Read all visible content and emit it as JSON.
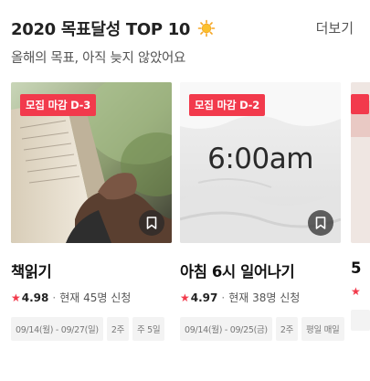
{
  "header": {
    "title": "2020 목표달성 TOP 10",
    "title_icon": "sun-icon",
    "more_label": "더보기",
    "subtitle": "올해의 목표, 아직 늦지 않았어요"
  },
  "cards": [
    {
      "badge": "모집 마감 D-3",
      "title": "책읽기",
      "rating": "4.98",
      "participants": "현재 45명 신청",
      "tags": [
        "09/14(월) - 09/27(일)",
        "2주",
        "주 5일"
      ],
      "image": "reading-book"
    },
    {
      "badge": "모집 마감 D-2",
      "title": "아침 6시 일어나기",
      "rating": "4.97",
      "participants": "현재 38명 신청",
      "tags": [
        "09/14(월) - 09/25(금)",
        "2주",
        "평일 매일"
      ],
      "image_text": "6:00am"
    },
    {
      "title": "5",
      "rating": "",
      "image": "partial-card"
    }
  ],
  "colors": {
    "accent": "#f23a4c",
    "tag_bg": "#f3f3f3"
  }
}
